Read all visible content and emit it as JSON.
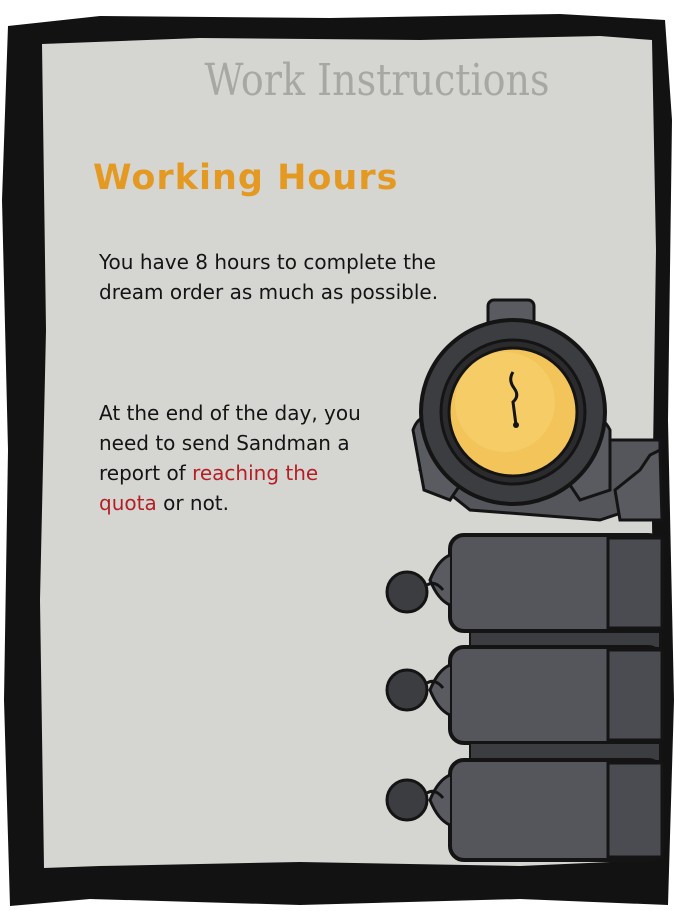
{
  "page": {
    "title": "Work Instructions",
    "heading": "Working Hours",
    "paragraph1": "You have 8 hours to complete the dream order as much as possible.",
    "paragraph2_prefix": "At the end of the day, you need to send Sandman a report of",
    "paragraph2_highlight": "reaching the quota",
    "paragraph2_suffix": "or not."
  },
  "colors": {
    "paper": "#d4d4d1",
    "border": "#121212",
    "title": "#a7a7a3",
    "heading": "#e49a22",
    "highlight": "#b51f24",
    "machine": "#56575c",
    "clock_face": "#f3c45a"
  },
  "icons": {
    "machine": "dream-machine-clock-icon"
  }
}
